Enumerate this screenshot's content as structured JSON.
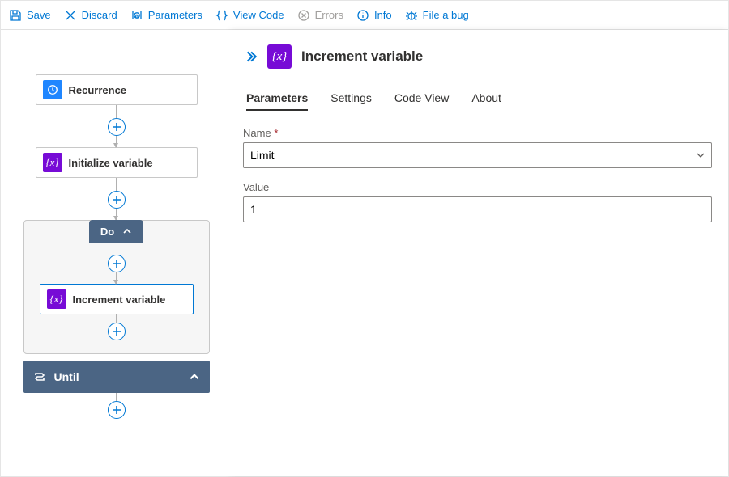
{
  "toolbar": {
    "save": "Save",
    "discard": "Discard",
    "parameters": "Parameters",
    "viewcode": "View Code",
    "errors": "Errors",
    "info": "Info",
    "fileabug": "File a bug"
  },
  "flow": {
    "recurrence": "Recurrence",
    "initialize": "Initialize variable",
    "do": "Do",
    "increment": "Increment variable",
    "until": "Until"
  },
  "panel": {
    "title": "Increment variable",
    "tabs": {
      "parameters": "Parameters",
      "settings": "Settings",
      "codeview": "Code View",
      "about": "About"
    },
    "fields": {
      "name_label": "Name",
      "name_value": "Limit",
      "value_label": "Value",
      "value_value": "1"
    }
  }
}
